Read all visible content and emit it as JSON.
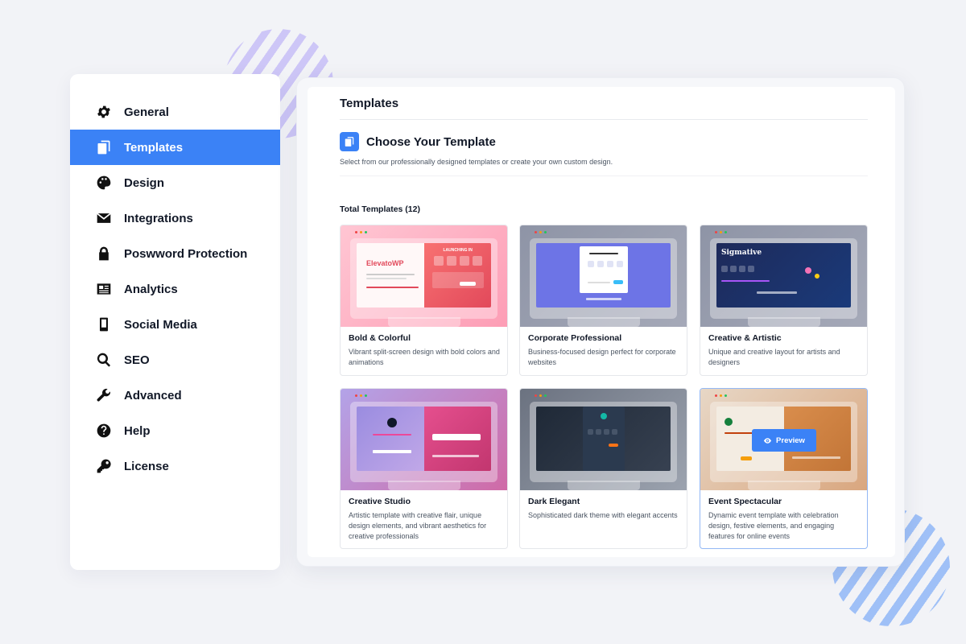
{
  "sidebar": {
    "items": [
      {
        "label": "General",
        "icon": "gear-icon",
        "active": false
      },
      {
        "label": "Templates",
        "icon": "copy-icon",
        "active": true
      },
      {
        "label": "Design",
        "icon": "palette-icon",
        "active": false
      },
      {
        "label": "Integrations",
        "icon": "envelope-icon",
        "active": false
      },
      {
        "label": "Poswword Protection",
        "icon": "lock-icon",
        "active": false
      },
      {
        "label": "Analytics",
        "icon": "newspaper-icon",
        "active": false
      },
      {
        "label": "Social Media",
        "icon": "mobile-icon",
        "active": false
      },
      {
        "label": "SEO",
        "icon": "search-icon",
        "active": false
      },
      {
        "label": "Advanced",
        "icon": "wrench-icon",
        "active": false
      },
      {
        "label": "Help",
        "icon": "question-circle-icon",
        "active": false
      },
      {
        "label": "License",
        "icon": "key-icon",
        "active": false
      }
    ]
  },
  "main": {
    "page_title": "Templates",
    "section_title": "Choose Your Template",
    "section_subtitle": "Select from our professionally designed templates or create your own custom design.",
    "total_label": "Total Templates (12)",
    "preview_label": "Preview",
    "thumb_texts": {
      "elevato_brand": "ElevatoWP",
      "elevato_heading": "LAUNCHING IN",
      "sigmative": "Sigmative"
    },
    "templates": [
      {
        "name": "Bold & Colorful",
        "description": "Vibrant split-screen design with bold colors and animations"
      },
      {
        "name": "Corporate Professional",
        "description": "Business-focused design perfect for corporate websites"
      },
      {
        "name": "Creative & Artistic",
        "description": "Unique and creative layout for artists and designers"
      },
      {
        "name": "Creative Studio",
        "description": "Artistic template with creative flair, unique design elements, and vibrant aesthetics for creative professionals"
      },
      {
        "name": "Dark Elegant",
        "description": "Sophisticated dark theme with elegant accents"
      },
      {
        "name": "Event Spectacular",
        "description": "Dynamic event template with celebration design, festive elements, and engaging features for online events"
      }
    ]
  },
  "colors": {
    "accent": "#3b82f6",
    "background": "#f2f3f7"
  }
}
